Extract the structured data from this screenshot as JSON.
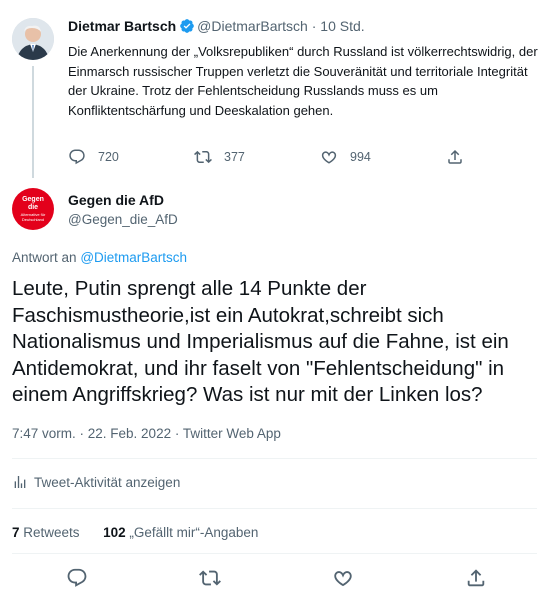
{
  "parent": {
    "name": "Dietmar Bartsch",
    "handle": "@DietmarBartsch",
    "separator": "·",
    "time": "10 Std.",
    "text": "Die Anerkennung der „Volksrepubliken“ durch Russland ist völkerrechtswidrig, der Einmarsch russischer Truppen verletzt die Souveränität und territoriale Integrität der Ukraine. Trotz der Fehlentscheidung Russlands muss es um Konfliktentschärfung und Deeskalation gehen.",
    "replies": "720",
    "retweets": "377",
    "likes": "994"
  },
  "main": {
    "avatar_text_1": "Gegen",
    "avatar_text_2": "die",
    "avatar_text_3": "Alternative für Deutschland",
    "name": "Gegen die AfD",
    "handle": "@Gegen_die_AfD",
    "replying_prefix": "Antwort an",
    "replying_to": "@DietmarBartsch",
    "text": "Leute, Putin sprengt alle 14 Punkte der Faschismustheorie,ist ein Autokrat,schreibt sich Nationalismus und Imperialismus auf die Fahne, ist ein Antidemokrat, und ihr faselt von \"Fehlentscheidung\" in einem Angriffskrieg? Was ist nur mit der Linken los?",
    "meta": "7:47 vorm. · 22. Feb. 2022 · Twitter Web App",
    "activity_label": "Tweet-Aktivität anzeigen",
    "retweet_count": "7",
    "retweet_label": "Retweets",
    "like_count": "102",
    "like_label": "„Gefällt mir“-Angaben"
  },
  "colors": {
    "accent": "#1d9bf0",
    "secondary_text": "#536471",
    "avatar_red": "#e3001b"
  },
  "icons": [
    "verified-badge-icon",
    "reply-icon",
    "retweet-icon",
    "like-icon",
    "share-icon",
    "analytics-icon"
  ]
}
